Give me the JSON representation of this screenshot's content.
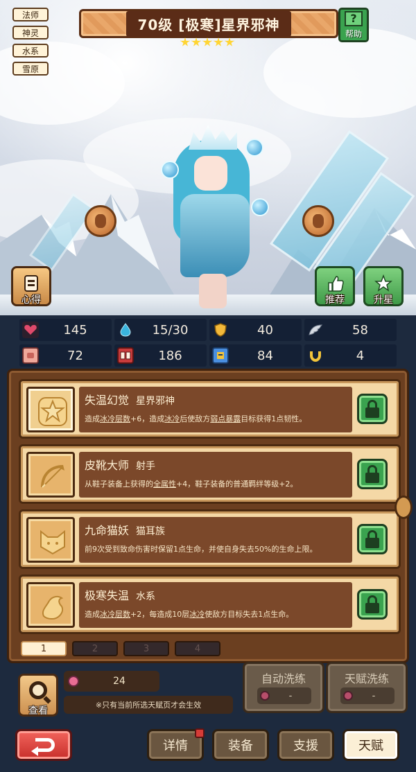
{
  "hero": {
    "title": "70级 [极寒]星界邪神",
    "star_count": 5,
    "tags": [
      "法师",
      "神灵",
      "水系",
      "雪原"
    ]
  },
  "top_buttons": {
    "help": "帮助",
    "notes": "心得",
    "recommend": "推荐",
    "upgrade": "升星"
  },
  "stats": [
    {
      "icon": "heart-icon",
      "value": "145",
      "color": "#e04a6b"
    },
    {
      "icon": "water-drop-icon",
      "value": "15/30",
      "color": "#3ab4de"
    },
    {
      "icon": "shield-icon",
      "value": "40",
      "color": "#f3b93a"
    },
    {
      "icon": "wing-icon",
      "value": "58",
      "color": "#d6dbe3"
    },
    {
      "icon": "fist-icon",
      "value": "72",
      "color": "#f0a89a"
    },
    {
      "icon": "spellbook-icon",
      "value": "186",
      "color": "#c93c3c"
    },
    {
      "icon": "scroll-icon",
      "value": "84",
      "color": "#4a8fe0"
    },
    {
      "icon": "horseshoe-icon",
      "value": "4",
      "color": "#f3c43a"
    }
  ],
  "talents": [
    {
      "name": "失温幻觉",
      "type": "星界邪神",
      "desc_parts": [
        "造成",
        "冰冷层数",
        "+6，造成",
        "冰冷",
        "后使敌方",
        "弱点暴露",
        "目标获得1点韧性。"
      ],
      "icon": "star-badge-icon"
    },
    {
      "name": "皮靴大师",
      "type": "射手",
      "desc_parts": [
        "从鞋子装备上获得的",
        "全属性",
        "+4，鞋子装备的普通羁绊等级+2。"
      ],
      "icon": "bow-icon"
    },
    {
      "name": "九命猫妖",
      "type": "猫耳族",
      "desc_parts": [
        "前9次受到致命伤害时保留1点生命，并使自身失去50%的生命上限。"
      ],
      "icon": "cat-head-icon"
    },
    {
      "name": "极寒失温",
      "type": "水系",
      "desc_parts": [
        "造成",
        "冰冷层数",
        "+2，每造成10层",
        "冰冷",
        "使敌方目标失去1点生命。"
      ],
      "icon": "water-splash-icon"
    }
  ],
  "pages": [
    "1",
    "2",
    "3",
    "4"
  ],
  "bottom": {
    "view_label": "查看",
    "potion_count": "24",
    "notice": "※只有当前所选天赋页才会生效",
    "auto_wash": "自动洗练",
    "talent_wash": "天赋洗练",
    "wash_cost": "-"
  },
  "nav": {
    "details": "详情",
    "equipment": "装备",
    "support": "支援",
    "talent": "天赋"
  }
}
